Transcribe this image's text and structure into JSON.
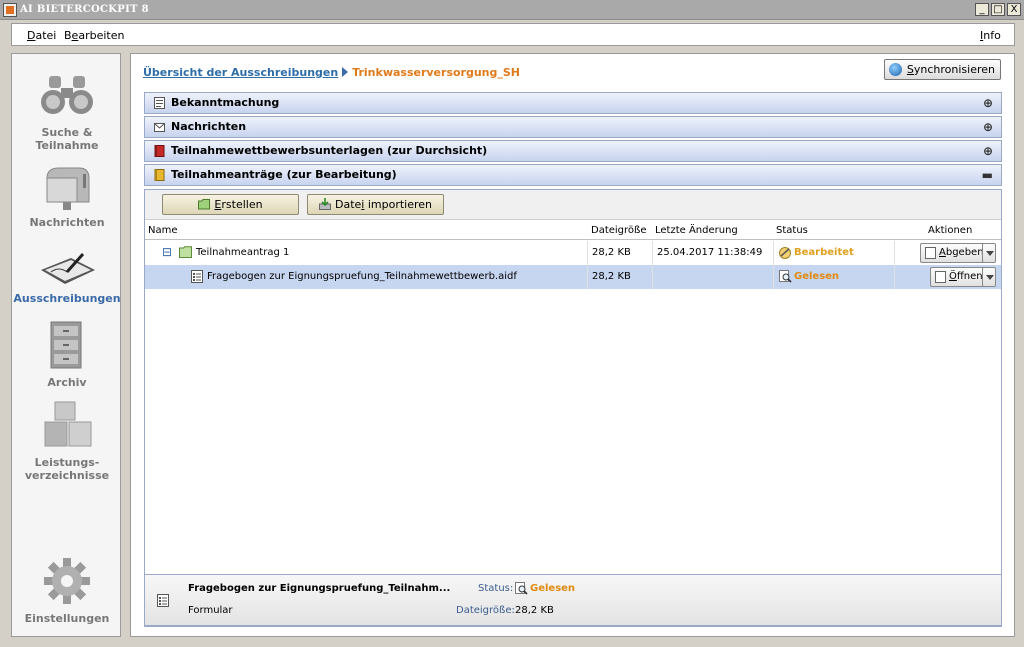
{
  "window": {
    "title": "AI BIETERCOCKPIT 8",
    "minimize": "_",
    "maximize": "□",
    "close": "X"
  },
  "menu": {
    "datei_u": "D",
    "datei_rest": "atei",
    "bearbeiten_pre": "B",
    "bearbeiten_u": "e",
    "bearbeiten_rest": "arbeiten",
    "info_u": "I",
    "info_rest": "nfo"
  },
  "nav": {
    "search": "Suche & Teilnahme",
    "messages": "Nachrichten",
    "tenders": "Ausschreibungen",
    "archive": "Archiv",
    "services": "Leistungs-verzeichnisse",
    "settings": "Einstellungen"
  },
  "breadcrumb": {
    "parent": "Übersicht der Ausschreibungen",
    "current": "Trinkwasserversorgung_SH"
  },
  "sync_button": {
    "u": "S",
    "rest": "ynchronisieren"
  },
  "sections": [
    {
      "label": "Bekanntmachung",
      "toggle": "⊕"
    },
    {
      "label": "Nachrichten",
      "toggle": "⊕"
    },
    {
      "label": "Teilnahmewettbewerbsunterlagen (zur Durchsicht)",
      "toggle": "⊕"
    },
    {
      "label": "Teilnahmeanträge (zur Bearbeitung)",
      "toggle": "▬"
    }
  ],
  "toolbar": {
    "create_u": "E",
    "create_rest": "rstellen",
    "import_pre": "Date",
    "import_u": "i",
    "import_rest": " importieren"
  },
  "table": {
    "headers": {
      "name": "Name",
      "size": "Dateigröße",
      "changed": "Letzte Änderung",
      "status": "Status",
      "actions": "Aktionen"
    },
    "rows": [
      {
        "expander": "⊟",
        "name": "Teilnahmeantrag 1",
        "size": "28,2 KB",
        "changed": "25.04.2017 11:38:49",
        "status": "Bearbeitet",
        "action_u": "A",
        "action_rest": "bgeben"
      },
      {
        "name": "Fragebogen zur Eignungspruefung_Teilnahmewettbewerb.aidf",
        "size": "28,2 KB",
        "changed": "",
        "status": "Gelesen",
        "action_u": "Ö",
        "action_rest": "ffnen"
      }
    ]
  },
  "details": {
    "name": "Fragebogen zur Eignungspruefung_Teilnahm...",
    "type": "Formular",
    "status_label": "Status:",
    "status_value": "Gelesen",
    "size_label": "Dateigröße:",
    "size_value": "28,2 KB"
  },
  "colors": {
    "accent": "#3a6aa8",
    "orange": "#e07a1a",
    "selected": "#c6d5f0"
  }
}
